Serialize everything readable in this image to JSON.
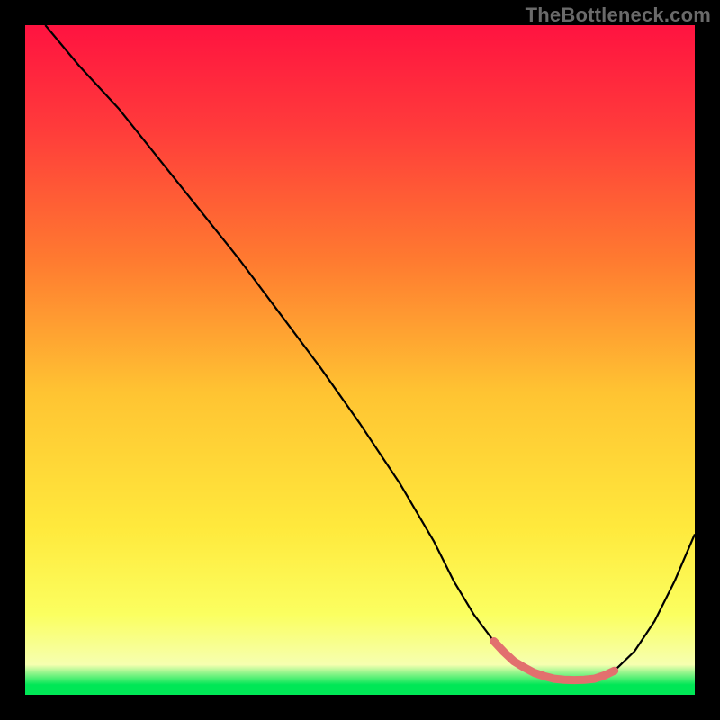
{
  "watermark": "TheBottleneck.com",
  "chart_data": {
    "type": "line",
    "title": "",
    "xlabel": "",
    "ylabel": "",
    "xlim": [
      0,
      100
    ],
    "ylim": [
      0,
      100
    ],
    "grid": false,
    "legend": false,
    "background": {
      "type": "vertical-gradient",
      "stops": [
        {
          "offset": 0.0,
          "color": "#ff1340"
        },
        {
          "offset": 0.15,
          "color": "#ff3a3b"
        },
        {
          "offset": 0.35,
          "color": "#ff7a30"
        },
        {
          "offset": 0.55,
          "color": "#ffc432"
        },
        {
          "offset": 0.75,
          "color": "#ffe93c"
        },
        {
          "offset": 0.88,
          "color": "#fbff60"
        },
        {
          "offset": 0.955,
          "color": "#f6ffb0"
        },
        {
          "offset": 0.985,
          "color": "#00e756"
        },
        {
          "offset": 1.0,
          "color": "#00e756"
        }
      ]
    },
    "series": [
      {
        "name": "bottleneck-curve",
        "color": "#000000",
        "width": 2.2,
        "x": [
          3,
          8,
          14,
          20,
          26,
          32,
          38,
          44,
          50,
          56,
          61,
          64,
          67,
          70,
          73,
          76,
          79,
          82,
          85,
          88,
          91,
          94,
          97,
          100
        ],
        "values": [
          100,
          94,
          87.5,
          80,
          72.5,
          65,
          57,
          49,
          40.5,
          31.5,
          23,
          17,
          12,
          8,
          5,
          3.3,
          2.4,
          2.2,
          2.4,
          3.6,
          6.5,
          11,
          17,
          24
        ]
      },
      {
        "name": "optimal-band",
        "color": "#e2706e",
        "width": 9,
        "linecap": "round",
        "x": [
          70,
          71.5,
          73,
          74.5,
          76,
          77.5,
          79,
          80.5,
          82,
          83.5,
          85,
          86.5,
          88
        ],
        "values": [
          8,
          6.4,
          5,
          4.1,
          3.3,
          2.8,
          2.4,
          2.25,
          2.2,
          2.25,
          2.4,
          2.9,
          3.6
        ]
      }
    ]
  }
}
